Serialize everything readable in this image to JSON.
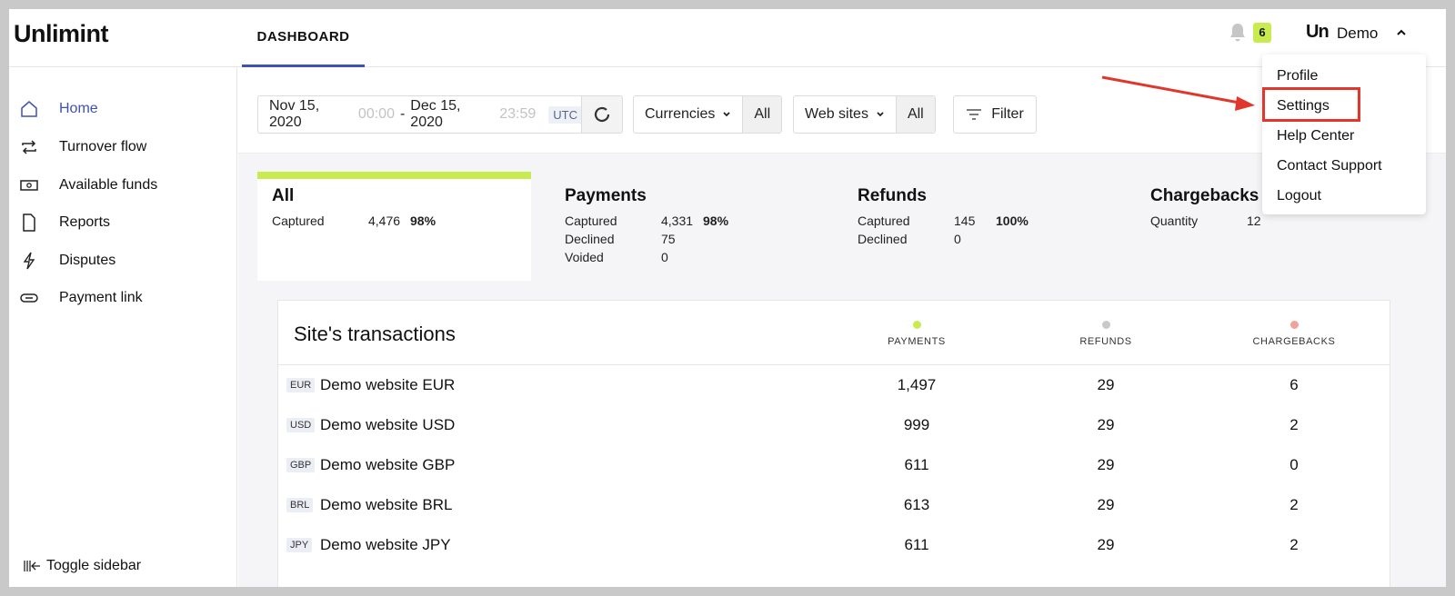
{
  "brand": {
    "logo_text": "Unlimint",
    "accent": "#3f51b5",
    "lime": "#c8ec4f",
    "highlight": "#e0362b"
  },
  "header": {
    "tab_label": "DASHBOARD",
    "notifications_count": "6",
    "user_mark": "Un",
    "user_name": "Demo"
  },
  "user_menu": {
    "items": [
      "Profile",
      "Settings",
      "Help Center",
      "Contact Support",
      "Logout"
    ],
    "highlighted": "Settings"
  },
  "sidebar": {
    "items": [
      {
        "label": "Home",
        "icon": "home-icon",
        "active": true
      },
      {
        "label": "Turnover flow",
        "icon": "repeat-icon"
      },
      {
        "label": "Available funds",
        "icon": "banknote-icon"
      },
      {
        "label": "Reports",
        "icon": "document-icon"
      },
      {
        "label": "Disputes",
        "icon": "lightning-icon"
      },
      {
        "label": "Payment link",
        "icon": "link-icon"
      }
    ],
    "toggle_label": "Toggle sidebar"
  },
  "filters": {
    "date_from": "Nov 15, 2020",
    "time_from": "00:00",
    "separator": "-",
    "date_to": "Dec 15, 2020",
    "time_to": "23:59",
    "timezone": "UTC",
    "currencies_label": "Currencies",
    "currencies_value": "All",
    "websites_label": "Web sites",
    "websites_value": "All",
    "filter_label": "Filter"
  },
  "cards": [
    {
      "title": "All",
      "rows": [
        {
          "k": "Captured",
          "v": "4,476",
          "p": "98%"
        }
      ]
    },
    {
      "title": "Payments",
      "rows": [
        {
          "k": "Captured",
          "v": "4,331",
          "p": "98%"
        },
        {
          "k": "Declined",
          "v": "75",
          "p": ""
        },
        {
          "k": "Voided",
          "v": "0",
          "p": ""
        }
      ]
    },
    {
      "title": "Refunds",
      "rows": [
        {
          "k": "Captured",
          "v": "145",
          "p": "100%"
        },
        {
          "k": "Declined",
          "v": "0",
          "p": ""
        }
      ]
    },
    {
      "title": "Chargebacks",
      "rows": [
        {
          "k": "Quantity",
          "v": "12",
          "p": ""
        }
      ]
    }
  ],
  "transactions": {
    "title": "Site's transactions",
    "columns": [
      {
        "label": "PAYMENTS",
        "color": "#c8ec4f"
      },
      {
        "label": "REFUNDS",
        "color": "#c9c9c9"
      },
      {
        "label": "CHARGEBACKS",
        "color": "#f0a39b"
      }
    ],
    "rows": [
      {
        "currency": "EUR",
        "site": "Demo website EUR",
        "payments": "1,497",
        "refunds": "29",
        "chargebacks": "6"
      },
      {
        "currency": "USD",
        "site": "Demo website USD",
        "payments": "999",
        "refunds": "29",
        "chargebacks": "2"
      },
      {
        "currency": "GBP",
        "site": "Demo website GBP",
        "payments": "611",
        "refunds": "29",
        "chargebacks": "0"
      },
      {
        "currency": "BRL",
        "site": "Demo website BRL",
        "payments": "613",
        "refunds": "29",
        "chargebacks": "2"
      },
      {
        "currency": "JPY",
        "site": "Demo website JPY",
        "payments": "611",
        "refunds": "29",
        "chargebacks": "2"
      }
    ]
  }
}
